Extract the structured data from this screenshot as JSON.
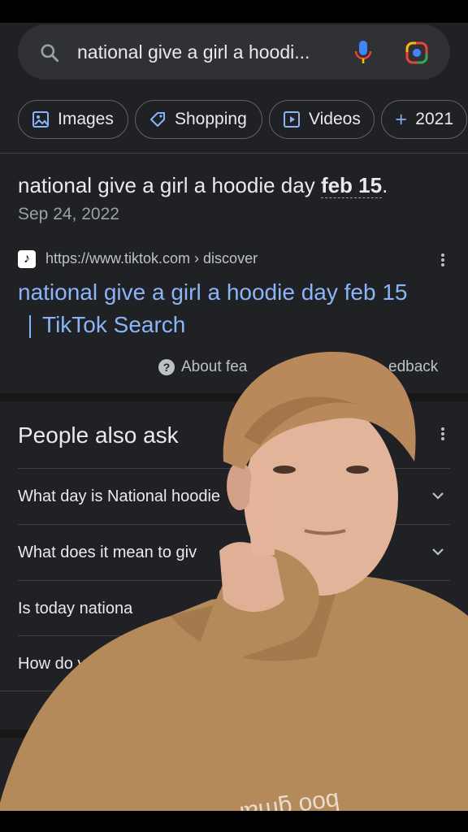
{
  "search": {
    "query": "national give a girl a hoodi..."
  },
  "icons": {
    "search": "search-icon",
    "mic": "mic-icon",
    "lens": "google-lens-icon",
    "more": "more-vert-icon",
    "about": "help-icon",
    "chevron": "chevron-down-icon",
    "tiktok": "tiktok-icon"
  },
  "chips": [
    {
      "label": "Images",
      "icon": "image-icon"
    },
    {
      "label": "Shopping",
      "icon": "tag-icon"
    },
    {
      "label": "Videos",
      "icon": "play-icon"
    },
    {
      "label": "2021",
      "icon": "plus-icon"
    }
  ],
  "snippet": {
    "text": "national give a girl a hoodie day ",
    "bold": "feb 15",
    "end": ".",
    "date": "Sep 24, 2022"
  },
  "result": {
    "url": "https://www.tiktok.com › discover",
    "title_line1": "national give a girl a hoodie day feb 15",
    "title_line2": "TikTok Search",
    "about": "About fea",
    "feedback": "edback"
  },
  "paa": {
    "title": "People also ask",
    "questions": [
      "What day is National hoodie",
      "What does it mean to giv",
      "Is today nationa",
      "How do y"
    ]
  },
  "colors": {
    "background": "#202124",
    "link": "#8ab4f8",
    "text": "#e8eaed",
    "muted": "#9aa0a6",
    "hoodie": "#b58a5a"
  }
}
